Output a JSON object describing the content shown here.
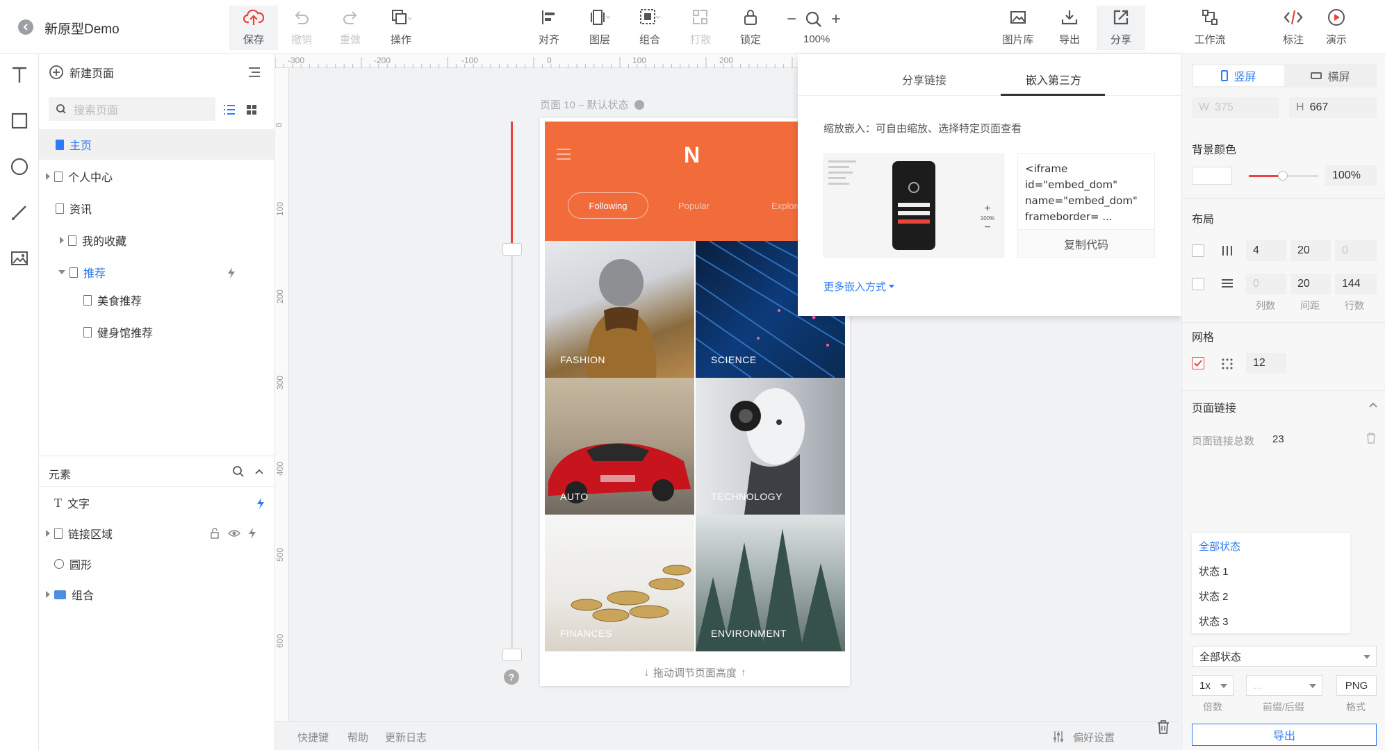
{
  "app": {
    "title": "新原型Demo"
  },
  "toolbar": {
    "save": "保存",
    "undo": "撤销",
    "redo": "重做",
    "operate": "操作",
    "align": "对齐",
    "layers": "图层",
    "group": "组合",
    "break": "打散",
    "lock": "锁定",
    "zoom": "100%",
    "library": "图片库",
    "export": "导出",
    "share": "分享",
    "workflow": "工作流",
    "annotate": "标注",
    "present": "演示"
  },
  "pages": {
    "new_page": "新建页面",
    "search_placeholder": "搜索页面",
    "items": [
      "主页",
      "个人中心",
      "资讯",
      "我的收藏",
      "推荐",
      "美食推荐",
      "健身馆推荐"
    ]
  },
  "elements": {
    "title": "元素",
    "items": [
      "文字",
      "链接区域",
      "圆形",
      "组合"
    ]
  },
  "canvas": {
    "page_label": "页面 10 – 默认状态",
    "ruler_h": [
      "-300",
      "-200",
      "-100",
      "0",
      "100",
      "200"
    ],
    "ruler_v": [
      "0",
      "100",
      "200",
      "300",
      "400",
      "500",
      "600"
    ],
    "drag_hint": "拖动调节页面高度",
    "help": "?"
  },
  "phone": {
    "logo": "N",
    "tabs": [
      "Following",
      "Popular",
      "Explore"
    ],
    "tiles": [
      "FASHION",
      "SCIENCE",
      "AUTO",
      "TECHNOLOGY",
      "FINANCES",
      "ENVIRONMENT"
    ]
  },
  "share_popup": {
    "tab_link": "分享链接",
    "tab_embed": "嵌入第三方",
    "desc": "缩放嵌入：可自由缩放、选择特定页面查看",
    "code_lines": [
      "<iframe",
      "id=\"embed_dom\"",
      "name=\"embed_dom\"",
      "frameborder= ..."
    ],
    "copy_btn": "复制代码",
    "more": "更多嵌入方式",
    "mini_zoom": "100%"
  },
  "right": {
    "portrait": "竖屏",
    "landscape": "横屏",
    "w_label": "W",
    "w_value": "375",
    "h_label": "H",
    "h_value": "667",
    "bg_title": "背景颜色",
    "bg_opacity": "100%",
    "layout_title": "布局",
    "col_val": "4",
    "col_gap": "20",
    "col_off": "0",
    "row_val": "0",
    "row_gap": "20",
    "row_count": "144",
    "cols_lbl": "列数",
    "gap_lbl": "间距",
    "rows_lbl": "行数",
    "grid_title": "网格",
    "grid_val": "12",
    "links_title": "页面链接",
    "links_total_lbl": "页面链接总数",
    "links_total": "23",
    "states": [
      "全部状态",
      "状态 1",
      "状态 2",
      "状态 3"
    ],
    "state_select": "全部状态",
    "scale": "1x",
    "prefix": "...",
    "format": "PNG",
    "scale_lbl": "倍数",
    "prefix_lbl": "前缀/后缀",
    "format_lbl": "格式",
    "export_btn": "导出"
  },
  "footer": {
    "shortcuts": "快捷键",
    "help": "帮助",
    "changelog": "更新日志",
    "prefs": "偏好设置"
  },
  "colors": {
    "accent": "#2f7bf5",
    "orange": "#f26b3a",
    "red": "#e8443a"
  }
}
